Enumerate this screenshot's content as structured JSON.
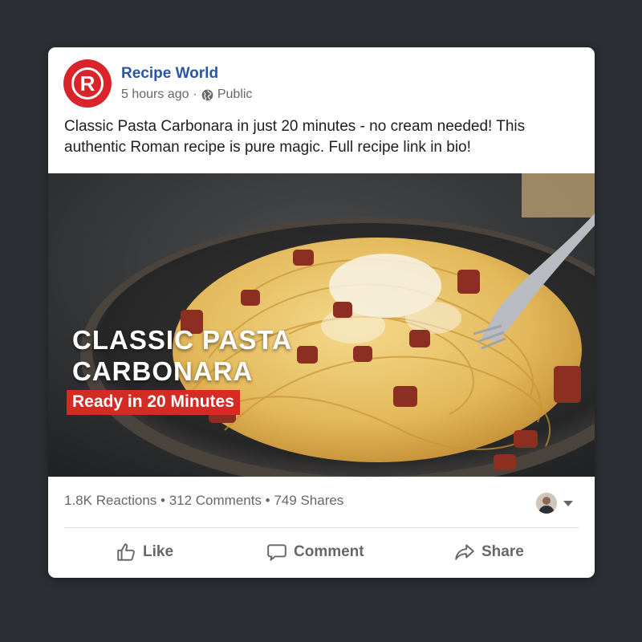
{
  "post": {
    "page_name": "Recipe World",
    "avatar_letter": "R",
    "time_ago": "5 hours ago",
    "separator": "·",
    "audience": "Public",
    "caption": "Classic Pasta Carbonara in just 20 minutes - no cream needed! This authentic Roman recipe is pure magic. Full recipe link in bio!"
  },
  "image": {
    "title": "CLASSIC PASTA CARBONARA",
    "badge": "Ready in 20 Minutes"
  },
  "stats": {
    "text": "1.8K Reactions • 312 Comments • 749 Shares"
  },
  "actions": {
    "like": "Like",
    "comment": "Comment",
    "share": "Share"
  },
  "colors": {
    "brand_red": "#d9242b",
    "page_name_blue": "#2a55a4",
    "badge_red": "#d42b24"
  },
  "icons": [
    "globe-icon",
    "like-icon",
    "comment-icon",
    "share-icon",
    "dropdown-caret-icon"
  ]
}
